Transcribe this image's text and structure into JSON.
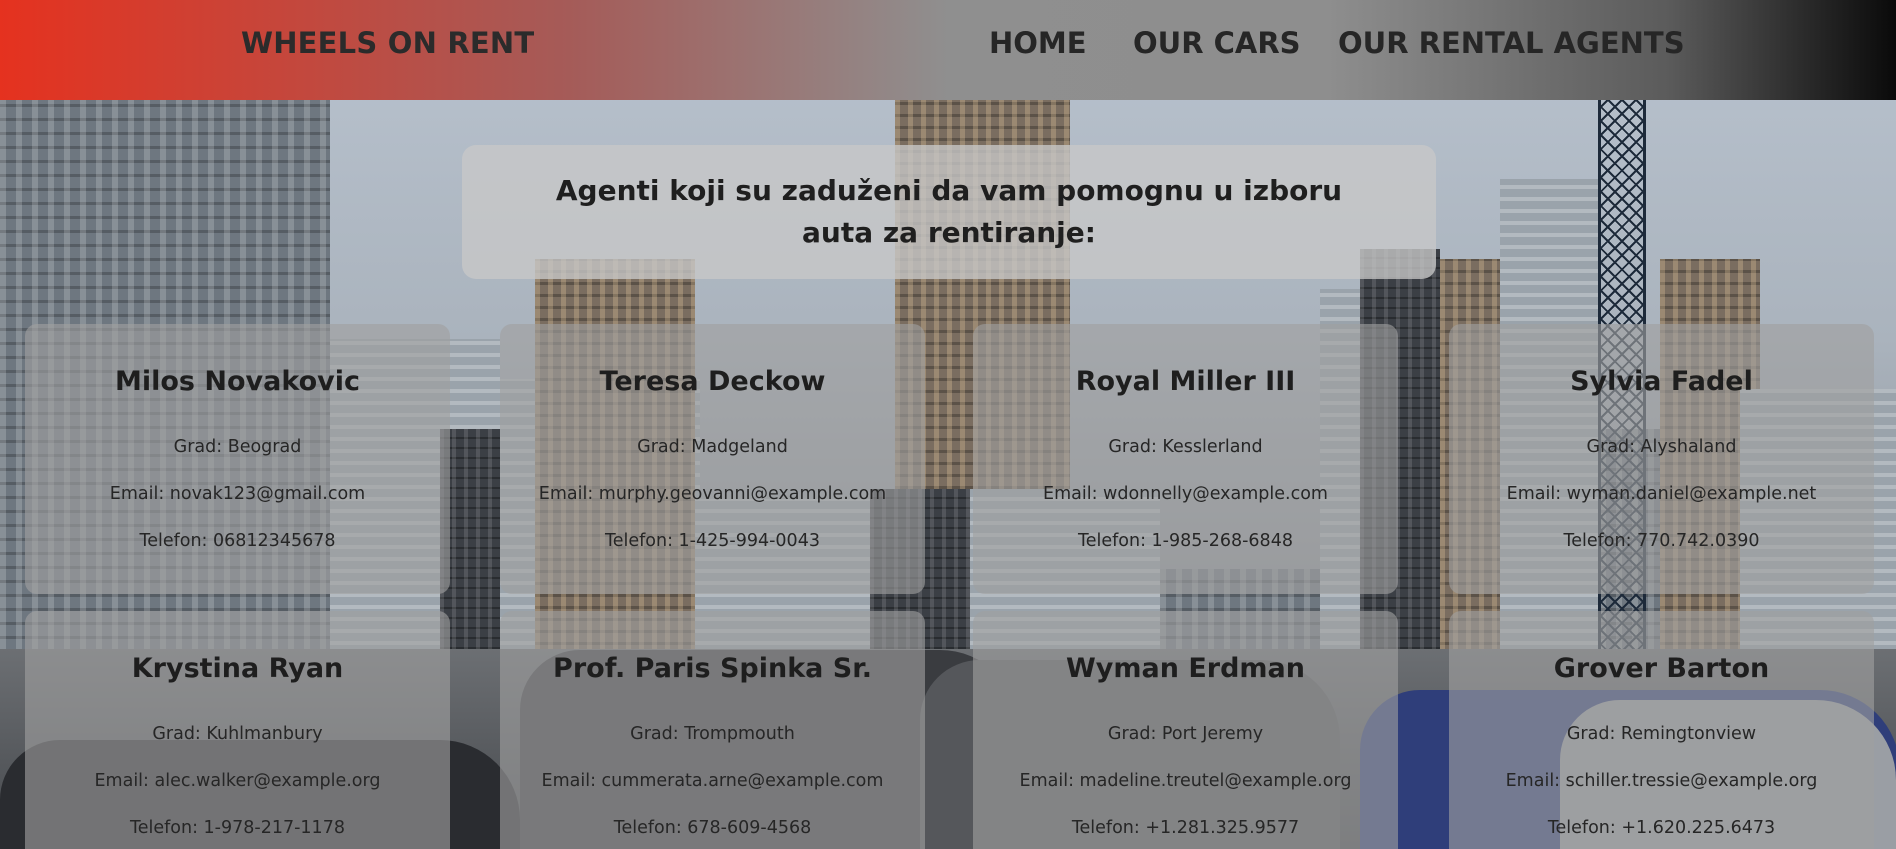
{
  "header": {
    "brand": "WHEELS ON RENT",
    "nav": [
      "HOME",
      "OUR CARS",
      "OUR RENTAL AGENTS"
    ]
  },
  "main": {
    "heading": "Agenti koji su zaduženi da vam pomognu u izboru auta za rentiranje:",
    "agents": [
      {
        "name": "Milos Novakovic",
        "city": "Grad: Beograd",
        "email": "Email: novak123@gmail.com",
        "phone": "Telefon: 06812345678"
      },
      {
        "name": "Teresa Deckow",
        "city": "Grad: Madgeland",
        "email": "Email: murphy.geovanni@example.com",
        "phone": "Telefon: 1-425-994-0043"
      },
      {
        "name": "Royal Miller III",
        "city": "Grad: Kesslerland",
        "email": "Email: wdonnelly@example.com",
        "phone": "Telefon: 1-985-268-6848"
      },
      {
        "name": "Sylvia Fadel",
        "city": "Grad: Alyshaland",
        "email": "Email: wyman.daniel@example.net",
        "phone": "Telefon: 770.742.0390"
      },
      {
        "name": "Krystina Ryan",
        "city": "Grad: Kuhlmanbury",
        "email": "Email: alec.walker@example.org",
        "phone": "Telefon: 1-978-217-1178"
      },
      {
        "name": "Prof. Paris Spinka Sr.",
        "city": "Grad: Trompmouth",
        "email": "Email: cummerata.arne@example.com",
        "phone": "Telefon: 678-609-4568"
      },
      {
        "name": "Wyman Erdman",
        "city": "Grad: Port Jeremy",
        "email": "Email: madeline.treutel@example.org",
        "phone": "Telefon: +1.281.325.9577"
      },
      {
        "name": "Grover Barton",
        "city": "Grad: Remingtonview",
        "email": "Email: schiller.tressie@example.org",
        "phone": "Telefon: +1.620.225.6473"
      }
    ]
  }
}
